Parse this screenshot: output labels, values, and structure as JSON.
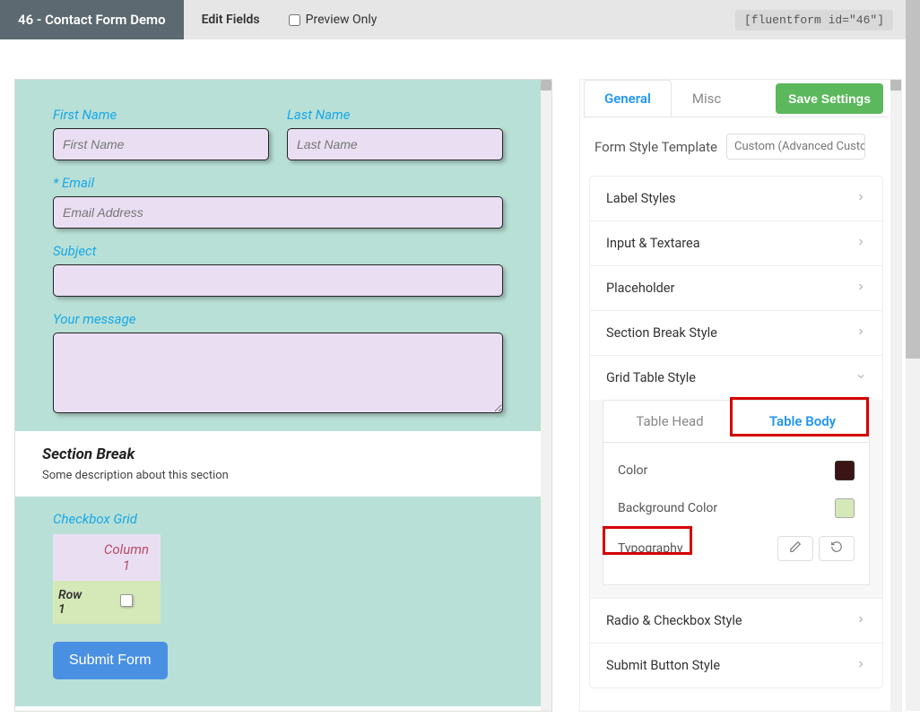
{
  "topbar": {
    "title": "46 - Contact Form Demo",
    "edit_fields": "Edit Fields",
    "preview_only": "Preview Only",
    "shortcode": "[fluentform id=\"46\"]"
  },
  "form": {
    "first_name_label": "First Name",
    "first_name_placeholder": "First Name",
    "last_name_label": "Last Name",
    "last_name_placeholder": "Last Name",
    "email_label": "Email",
    "email_required": "*",
    "email_placeholder": "Email Address",
    "subject_label": "Subject",
    "message_label": "Your message",
    "section_title": "Section Break",
    "section_desc": "Some description about this section",
    "grid_label": "Checkbox Grid",
    "grid_col1": "Column 1",
    "grid_row1": "Row 1",
    "submit": "Submit Form"
  },
  "sidebar": {
    "tab_general": "General",
    "tab_misc": "Misc",
    "save": "Save Settings",
    "template_label": "Form Style Template",
    "template_value": "Custom (Advanced Custom",
    "items": {
      "label_styles": "Label Styles",
      "input_textarea": "Input & Textarea",
      "placeholder": "Placeholder",
      "section_break": "Section Break Style",
      "grid_table": "Grid Table Style",
      "radio_checkbox": "Radio & Checkbox Style",
      "submit_button": "Submit Button Style"
    },
    "grid": {
      "tab_head": "Table Head",
      "tab_body": "Table Body",
      "color": "Color",
      "bgcolor": "Background Color",
      "typography": "Typography",
      "color_value": "#3b1414",
      "bgcolor_value": "#d4e8b8"
    }
  }
}
